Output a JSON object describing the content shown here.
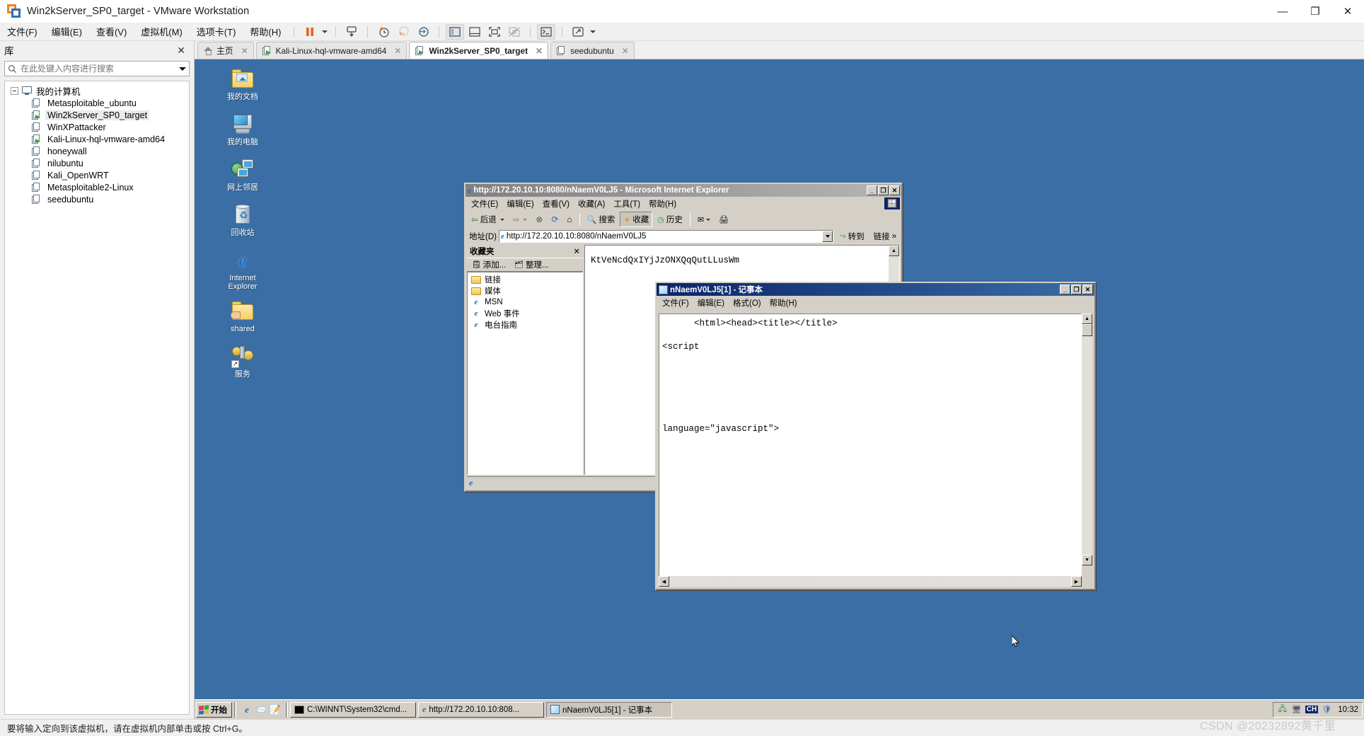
{
  "app": {
    "title": "Win2kServer_SP0_target - VMware Workstation",
    "icon": "vmware-logo-icon",
    "window_controls": {
      "minimize": "—",
      "maximize": "❐",
      "close": "✕"
    }
  },
  "menubar": {
    "items": [
      {
        "label": "文件(F)",
        "name": "menu-file"
      },
      {
        "label": "编辑(E)",
        "name": "menu-edit"
      },
      {
        "label": "查看(V)",
        "name": "menu-view"
      },
      {
        "label": "虚拟机(M)",
        "name": "menu-vm"
      },
      {
        "label": "选项卡(T)",
        "name": "menu-tabs"
      },
      {
        "label": "帮助(H)",
        "name": "menu-help"
      }
    ]
  },
  "toolbar": {
    "buttons": [
      {
        "name": "pause-button",
        "icon": "pause-icon"
      },
      {
        "name": "power-dropdown",
        "icon": "chevron-down-icon"
      },
      {
        "name": "send-ctrl-alt-del-button",
        "icon": "keyboard-send-icon"
      },
      {
        "name": "take-snapshot-button",
        "icon": "snapshot-add-icon"
      },
      {
        "name": "revert-snapshot-button",
        "icon": "snapshot-revert-icon"
      },
      {
        "name": "snapshot-manager-button",
        "icon": "snapshot-manager-icon"
      },
      {
        "name": "show-library-button",
        "icon": "library-panel-icon"
      },
      {
        "name": "show-thumbnail-bar-button",
        "icon": "thumbnail-bar-icon"
      },
      {
        "name": "fullscreen-button",
        "icon": "fullscreen-icon"
      },
      {
        "name": "unity-mode-button",
        "icon": "unity-mode-icon"
      },
      {
        "name": "console-button",
        "icon": "console-icon"
      },
      {
        "name": "stretch-button",
        "icon": "stretch-icon"
      },
      {
        "name": "stretch-dropdown",
        "icon": "chevron-down-icon"
      }
    ]
  },
  "library": {
    "title": "库",
    "close_label": "✕",
    "search": {
      "placeholder": "在此处键入内容进行搜索",
      "value": "",
      "icon": "search-icon",
      "dropdown_icon": "chevron-down-icon"
    },
    "root": {
      "label": "我的计算机",
      "icon": "monitor-icon"
    },
    "items": [
      {
        "label": "Metasploitable_ubuntu",
        "running": false,
        "selected": false
      },
      {
        "label": "Win2kServer_SP0_target",
        "running": true,
        "selected": true
      },
      {
        "label": "WinXPattacker",
        "running": false,
        "selected": false
      },
      {
        "label": "Kali-Linux-hql-vmware-amd64",
        "running": true,
        "selected": false
      },
      {
        "label": "honeywall",
        "running": false,
        "selected": false
      },
      {
        "label": "nilubuntu",
        "running": false,
        "selected": false
      },
      {
        "label": "Kali_OpenWRT",
        "running": false,
        "selected": false
      },
      {
        "label": "Metasploitable2-Linux",
        "running": false,
        "selected": false
      },
      {
        "label": "seedubuntu",
        "running": false,
        "selected": false
      }
    ]
  },
  "tabs": [
    {
      "label": "主页",
      "icon": "home-icon",
      "active": false,
      "close": "✕"
    },
    {
      "label": "Kali-Linux-hql-vmware-amd64",
      "icon": "vm-running-icon",
      "active": false,
      "close": "✕"
    },
    {
      "label": "Win2kServer_SP0_target",
      "icon": "vm-running-icon",
      "active": true,
      "close": "✕"
    },
    {
      "label": "seedubuntu",
      "icon": "vm-stopped-icon",
      "active": false,
      "close": "✕"
    }
  ],
  "desktop": {
    "background_color": "#3a6ea5",
    "icons": [
      {
        "label": "我的文档",
        "icon": "my-documents-icon"
      },
      {
        "label": "我的电脑",
        "icon": "my-computer-icon"
      },
      {
        "label": "网上邻居",
        "icon": "network-neighborhood-icon"
      },
      {
        "label": "回收站",
        "icon": "recycle-bin-icon"
      },
      {
        "label": "Internet Explorer",
        "icon": "internet-explorer-icon"
      },
      {
        "label": "shared",
        "icon": "shared-folder-icon"
      },
      {
        "label": "服务",
        "icon": "services-icon"
      }
    ]
  },
  "ie_window": {
    "title": "http://172.20.10.10:8080/nNaemV0LJ5 - Microsoft Internet Explorer",
    "icon": "internet-explorer-icon",
    "buttons": {
      "minimize": "_",
      "maximize": "❐",
      "close": "✕"
    },
    "menus": [
      "文件(E)",
      "编辑(E)",
      "查看(V)",
      "收藏(A)",
      "工具(T)",
      "帮助(H)"
    ],
    "toolbar": [
      {
        "label": "后退",
        "name": "back-button",
        "icon": "arrow-left-icon"
      },
      {
        "label": "",
        "name": "back-dropdown",
        "icon": "chevron-down-icon"
      },
      {
        "label": "",
        "name": "forward-button",
        "icon": "arrow-right-icon"
      },
      {
        "label": "",
        "name": "forward-dropdown",
        "icon": "chevron-down-icon"
      },
      {
        "label": "",
        "name": "stop-button",
        "icon": "stop-icon"
      },
      {
        "label": "",
        "name": "refresh-button",
        "icon": "refresh-icon"
      },
      {
        "label": "",
        "name": "home-button",
        "icon": "home-icon"
      },
      {
        "label": "搜索",
        "name": "search-button",
        "icon": "search-icon"
      },
      {
        "label": "收藏",
        "name": "favorites-button",
        "icon": "favorites-star-icon"
      },
      {
        "label": "历史",
        "name": "history-button",
        "icon": "history-icon"
      },
      {
        "label": "",
        "name": "mail-button",
        "icon": "mail-icon"
      },
      {
        "label": "",
        "name": "print-button",
        "icon": "printer-icon"
      }
    ],
    "address": {
      "label": "地址(D)",
      "value": "http://172.20.10.10:8080/nNaemV0LJ5",
      "go_label": "转到",
      "links_label": "链接",
      "links_more": "»"
    },
    "favorites_panel": {
      "title": "收藏夹",
      "close": "✕",
      "add_label": "添加...",
      "organize_label": "整理...",
      "items": [
        {
          "label": "链接",
          "type": "folder"
        },
        {
          "label": "媒体",
          "type": "folder"
        },
        {
          "label": "MSN",
          "type": "link"
        },
        {
          "label": "Web 事件",
          "type": "link"
        },
        {
          "label": "电台指南",
          "type": "link"
        }
      ]
    },
    "page_content": "KtVeNcdQxIYjJzONXQqQutLLusWm",
    "status_text": ""
  },
  "notepad_window": {
    "title": "nNaemV0LJ5[1] - 记事本",
    "icon": "notepad-icon",
    "buttons": {
      "minimize": "_",
      "maximize": "❐",
      "close": "✕"
    },
    "menus": [
      "文件(F)",
      "编辑(E)",
      "格式(O)",
      "帮助(H)"
    ],
    "content": "      <html><head><title></title>\n\n<script\n\n\n\n\n\n\nlanguage=\"javascript\">"
  },
  "win2k_taskbar": {
    "start_label": "开始",
    "quick_launch": [
      {
        "name": "ie-quicklaunch-icon",
        "icon": "internet-explorer-icon"
      },
      {
        "name": "outlook-quicklaunch-icon",
        "icon": "outlook-express-icon"
      },
      {
        "name": "desktop-quicklaunch-icon",
        "icon": "show-desktop-icon"
      }
    ],
    "tasks": [
      {
        "label": "C:\\WINNT\\System32\\cmd...",
        "icon": "cmd-icon",
        "active": false
      },
      {
        "label": "http://172.20.10.10:808...",
        "icon": "internet-explorer-icon",
        "active": false
      },
      {
        "label": "nNaemV0LJ5[1] - 记事本",
        "icon": "notepad-icon",
        "active": true
      }
    ],
    "tray": {
      "icons": [
        {
          "name": "network-tray-icon",
          "icon": "network-icon"
        },
        {
          "name": "display-tray-icon",
          "icon": "monitor-icon"
        },
        {
          "name": "ime-tray-icon",
          "icon": "CH"
        },
        {
          "name": "security-tray-icon",
          "icon": "shield-warning-icon"
        }
      ],
      "clock": "10:32"
    }
  },
  "vm_statusbar": {
    "hint": "要将输入定向到该虚拟机，请在虚拟机内部单击或按 Ctrl+G。",
    "watermark": "CSDN @20232892黄千里"
  }
}
